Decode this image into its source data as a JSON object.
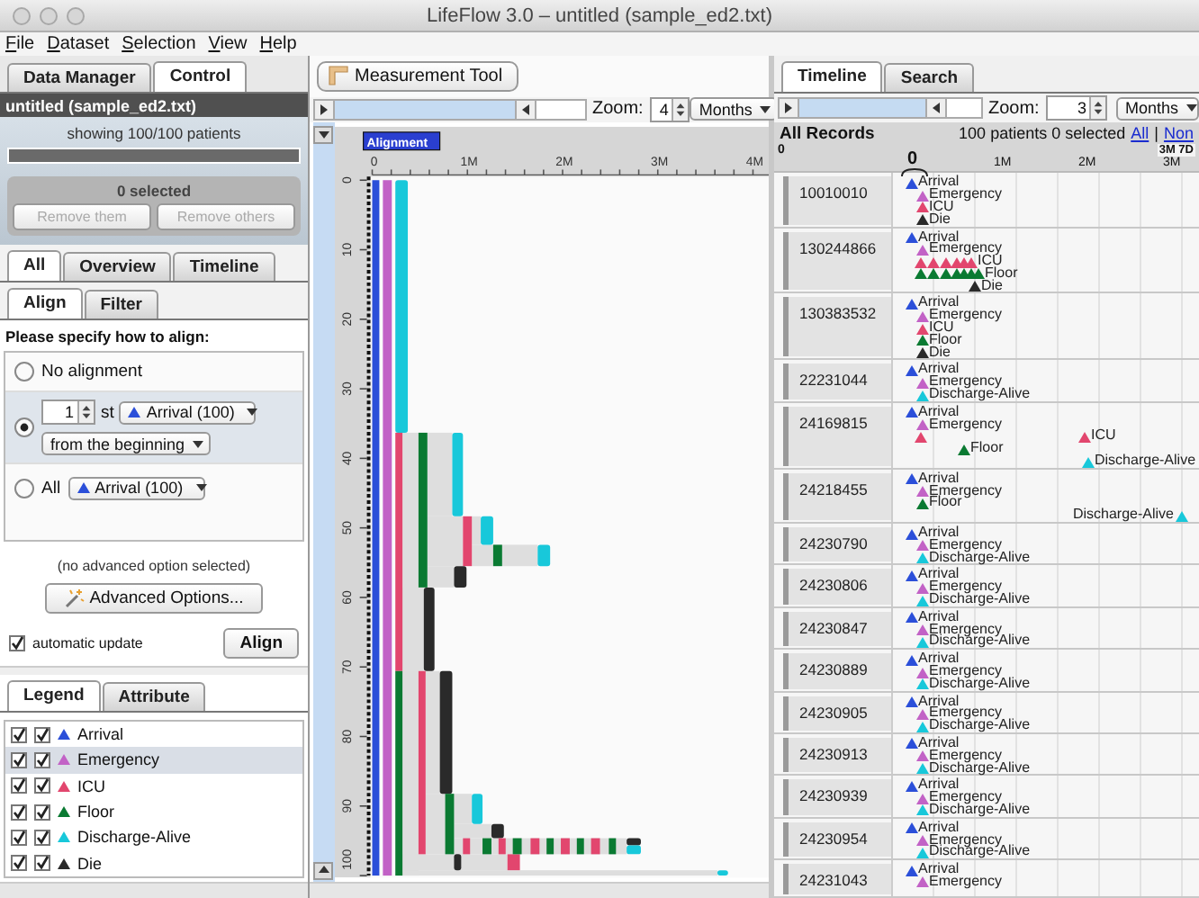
{
  "window": {
    "title": "LifeFlow 3.0 – untitled (sample_ed2.txt)"
  },
  "menu": [
    "File",
    "Dataset",
    "Selection",
    "View",
    "Help"
  ],
  "left_panel": {
    "tabs": [
      {
        "label": "Data Manager",
        "selected": false
      },
      {
        "label": "Control",
        "selected": true
      }
    ],
    "dataset": {
      "title": "untitled (sample_ed2.txt)",
      "showing": "showing 100/100 patients",
      "level": 1,
      "selected_count": "0 selected",
      "buttons": [
        {
          "label": "Remove them",
          "disabled": true
        },
        {
          "label": "Remove others",
          "disabled": true
        }
      ]
    },
    "view_tabs": [
      {
        "label": "All",
        "selected": true
      },
      {
        "label": "Overview",
        "selected": false
      },
      {
        "label": "Timeline",
        "selected": false
      }
    ],
    "sub_tabs": [
      {
        "label": "Align",
        "selected": true
      },
      {
        "label": "Filter",
        "selected": false
      }
    ],
    "prompt": "Please specify how to align:",
    "align_options": [
      {
        "kind": "plain",
        "label": "No alignment",
        "selected": false
      },
      {
        "kind": "nth",
        "selected": true,
        "count": "1",
        "suffix": "st",
        "event": {
          "kind": "arrival",
          "label": "Arrival (100)"
        },
        "direction": "from the beginning"
      },
      {
        "kind": "all",
        "selected": false,
        "label": "All",
        "event": {
          "kind": "arrival",
          "label": "Arrival (100)"
        }
      }
    ],
    "advanced_note": "(no advanced option selected)",
    "advanced_button": "Advanced Options...",
    "auto_update": {
      "label": "automatic update",
      "checked": true
    },
    "align_button": "Align",
    "legend_tabs": [
      {
        "label": "Legend",
        "selected": true
      },
      {
        "label": "Attribute",
        "selected": false
      }
    ],
    "legend": [
      {
        "kind": "arrival",
        "label": "Arrival",
        "color": "#2b4fd9",
        "checks": [
          true,
          true
        ],
        "selected": false
      },
      {
        "kind": "emergency",
        "label": "Emergency",
        "color": "#c262c6",
        "checks": [
          true,
          true
        ],
        "selected": true
      },
      {
        "kind": "icu",
        "label": "ICU",
        "color": "#e2466e",
        "checks": [
          true,
          true
        ],
        "selected": false
      },
      {
        "kind": "floor",
        "label": "Floor",
        "color": "#0a7a32",
        "checks": [
          true,
          true
        ],
        "selected": false
      },
      {
        "kind": "discharge",
        "label": "Discharge-Alive",
        "color": "#18c8da",
        "checks": [
          true,
          true
        ],
        "selected": false
      },
      {
        "kind": "die",
        "label": "Die",
        "color": "#2a2a2a",
        "checks": [
          true,
          true
        ],
        "selected": false
      }
    ]
  },
  "flow_panel": {
    "measure_button": "Measurement Tool",
    "zoom_label": "Zoom:",
    "zoom": "4",
    "unit": "Months",
    "alignment_tag": "Alignment",
    "x_ticks": [
      "0",
      "1M",
      "2M",
      "3M",
      "4M"
    ],
    "y_ticks": [
      "0",
      "10",
      "20",
      "30",
      "40",
      "50",
      "60",
      "70",
      "80",
      "90",
      "100"
    ]
  },
  "timeline_panel": {
    "tabs": [
      {
        "label": "Timeline",
        "selected": true
      },
      {
        "label": "Search",
        "selected": false
      }
    ],
    "zoom_label": "Zoom:",
    "zoom": "3",
    "unit": "Months",
    "header": "All Records",
    "summary": "100 patients 0 selected",
    "links": [
      "All",
      "Non"
    ],
    "separator": "|",
    "ruler": {
      "start": "0",
      "span": "3M 7D",
      "origin": "0",
      "ticks": [
        "1M",
        "2M",
        "3M"
      ]
    },
    "records": [
      {
        "id": "10010010",
        "events": [
          {
            "kind": "arrival",
            "label": "Arrival"
          },
          {
            "kind": "emergency",
            "label": "Emergency"
          },
          {
            "kind": "icu",
            "label": "ICU"
          },
          {
            "kind": "die",
            "label": "Die"
          }
        ]
      },
      {
        "id": "130244866",
        "events": [
          {
            "kind": "arrival",
            "label": "Arrival"
          },
          {
            "kind": "emergency",
            "label": "Emergency"
          },
          {
            "kind": "icu",
            "label": "ICU"
          },
          {
            "kind": "floor",
            "label": "Floor"
          },
          {
            "kind": "die",
            "label": "Die"
          }
        ]
      },
      {
        "id": "130383532",
        "events": [
          {
            "kind": "arrival",
            "label": "Arrival"
          },
          {
            "kind": "emergency",
            "label": "Emergency"
          },
          {
            "kind": "icu",
            "label": "ICU"
          },
          {
            "kind": "floor",
            "label": "Floor"
          },
          {
            "kind": "die",
            "label": "Die"
          }
        ]
      },
      {
        "id": "22231044",
        "events": [
          {
            "kind": "arrival",
            "label": "Arrival"
          },
          {
            "kind": "emergency",
            "label": "Emergency"
          },
          {
            "kind": "discharge",
            "label": "Discharge-Alive"
          }
        ]
      },
      {
        "id": "24169815",
        "events": [
          {
            "kind": "arrival",
            "label": "Arrival"
          },
          {
            "kind": "emergency",
            "label": "Emergency"
          },
          {
            "kind": "icu",
            "label": "ICU"
          },
          {
            "kind": "floor",
            "label": "Floor"
          },
          {
            "kind": "discharge",
            "label": "Discharge-Alive"
          }
        ]
      },
      {
        "id": "24218455",
        "events": [
          {
            "kind": "arrival",
            "label": "Arrival"
          },
          {
            "kind": "emergency",
            "label": "Emergency"
          },
          {
            "kind": "floor",
            "label": "Floor"
          },
          {
            "kind": "discharge",
            "label": "Discharge-Alive"
          }
        ]
      },
      {
        "id": "24230790",
        "events": [
          {
            "kind": "arrival",
            "label": "Arrival"
          },
          {
            "kind": "emergency",
            "label": "Emergency"
          },
          {
            "kind": "discharge",
            "label": "Discharge-Alive"
          }
        ]
      },
      {
        "id": "24230806",
        "events": [
          {
            "kind": "arrival",
            "label": "Arrival"
          },
          {
            "kind": "emergency",
            "label": "Emergency"
          },
          {
            "kind": "discharge",
            "label": "Discharge-Alive"
          }
        ]
      },
      {
        "id": "24230847",
        "events": [
          {
            "kind": "arrival",
            "label": "Arrival"
          },
          {
            "kind": "emergency",
            "label": "Emergency"
          },
          {
            "kind": "discharge",
            "label": "Discharge-Alive"
          }
        ]
      },
      {
        "id": "24230889",
        "events": [
          {
            "kind": "arrival",
            "label": "Arrival"
          },
          {
            "kind": "emergency",
            "label": "Emergency"
          },
          {
            "kind": "discharge",
            "label": "Discharge-Alive"
          }
        ]
      },
      {
        "id": "24230905",
        "events": [
          {
            "kind": "arrival",
            "label": "Arrival"
          },
          {
            "kind": "emergency",
            "label": "Emergency"
          },
          {
            "kind": "discharge",
            "label": "Discharge-Alive"
          }
        ]
      },
      {
        "id": "24230913",
        "events": [
          {
            "kind": "arrival",
            "label": "Arrival"
          },
          {
            "kind": "emergency",
            "label": "Emergency"
          },
          {
            "kind": "discharge",
            "label": "Discharge-Alive"
          }
        ]
      },
      {
        "id": "24230939",
        "events": [
          {
            "kind": "arrival",
            "label": "Arrival"
          },
          {
            "kind": "emergency",
            "label": "Emergency"
          },
          {
            "kind": "discharge",
            "label": "Discharge-Alive"
          }
        ]
      },
      {
        "id": "24230954",
        "events": [
          {
            "kind": "arrival",
            "label": "Arrival"
          },
          {
            "kind": "emergency",
            "label": "Emergency"
          },
          {
            "kind": "discharge",
            "label": "Discharge-Alive"
          }
        ]
      },
      {
        "id": "24231043",
        "events": [
          {
            "kind": "arrival",
            "label": "Arrival"
          },
          {
            "kind": "emergency",
            "label": "Emergency"
          }
        ]
      }
    ]
  }
}
